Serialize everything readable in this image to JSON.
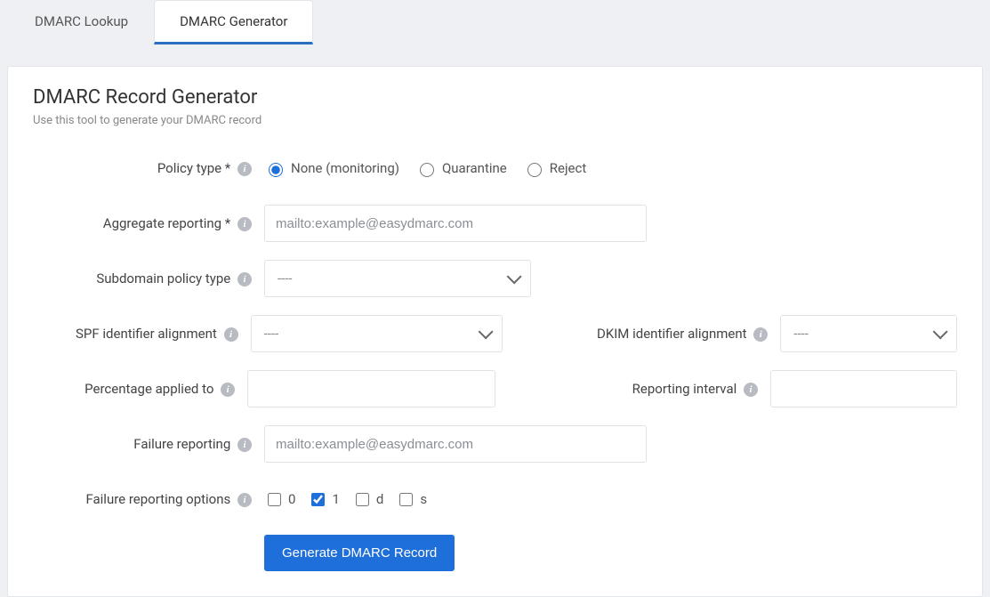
{
  "tabs": {
    "lookup": "DMARC Lookup",
    "generator": "DMARC Generator"
  },
  "page": {
    "title": "DMARC Record Generator",
    "subtitle": "Use this tool to generate your DMARC record"
  },
  "labels": {
    "policy_type": "Policy type *",
    "aggregate_reporting": "Aggregate reporting *",
    "subdomain_policy": "Subdomain policy type",
    "spf_align": "SPF identifier alignment",
    "dkim_align": "DKIM identifier alignment",
    "pct": "Percentage applied to",
    "interval": "Reporting interval",
    "failure_reporting": "Failure reporting",
    "failure_options": "Failure reporting options"
  },
  "policy_options": {
    "none": "None (monitoring)",
    "quarantine": "Quarantine",
    "reject": "Reject",
    "selected": "none"
  },
  "placeholders": {
    "mailto": "mailto:example@easydmarc.com"
  },
  "select_placeholder": "----",
  "values": {
    "aggregate_reporting": "",
    "subdomain_policy": "----",
    "spf_align": "----",
    "dkim_align": "----",
    "pct": "",
    "interval": "",
    "failure_reporting": ""
  },
  "failure_opts": {
    "o0": {
      "label": "0",
      "checked": false
    },
    "o1": {
      "label": "1",
      "checked": true
    },
    "od": {
      "label": "d",
      "checked": false
    },
    "os": {
      "label": "s",
      "checked": false
    }
  },
  "button": "Generate DMARC Record"
}
